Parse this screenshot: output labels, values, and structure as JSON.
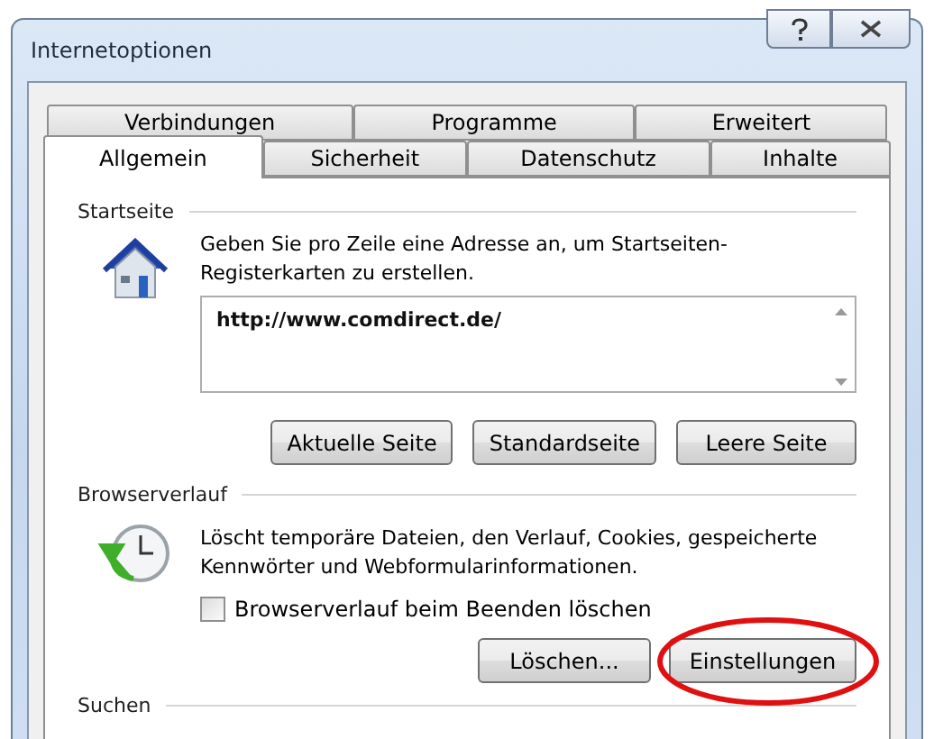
{
  "window": {
    "title": "Internetoptionen",
    "buttons": [
      {
        "kind": "help"
      },
      {
        "kind": "close"
      }
    ]
  },
  "tab_rows": [
    [
      {
        "label": "Verbindungen",
        "selected": false
      },
      {
        "label": "Programme",
        "selected": false
      },
      {
        "label": "Erweitert",
        "selected": false
      }
    ],
    [
      {
        "label": "Allgemein",
        "selected": true
      },
      {
        "label": "Sicherheit",
        "selected": false
      },
      {
        "label": "Datenschutz",
        "selected": false
      },
      {
        "label": "Inhalte",
        "selected": false
      }
    ]
  ],
  "startseite": {
    "heading": "Startseite",
    "description": "Geben Sie pro Zeile eine Adresse an, um Startseiten-Registerkarten zu erstellen.",
    "value": "http://www.comdirect.de/",
    "buttons": [
      "Aktuelle Seite",
      "Standardseite",
      "Leere Seite"
    ]
  },
  "browserverlauf": {
    "heading": "Browserverlauf",
    "description": "Löscht temporäre Dateien, den Verlauf, Cookies, gespeicherte Kennwörter und Webformularinformationen.",
    "checkbox": {
      "label": "Browserverlauf beim Beenden löschen",
      "checked": false
    },
    "buttons": [
      {
        "label": "Löschen...",
        "highlighted": false
      },
      {
        "label": "Einstellungen",
        "highlighted": true
      }
    ]
  },
  "suchen": {
    "heading": "Suchen"
  }
}
